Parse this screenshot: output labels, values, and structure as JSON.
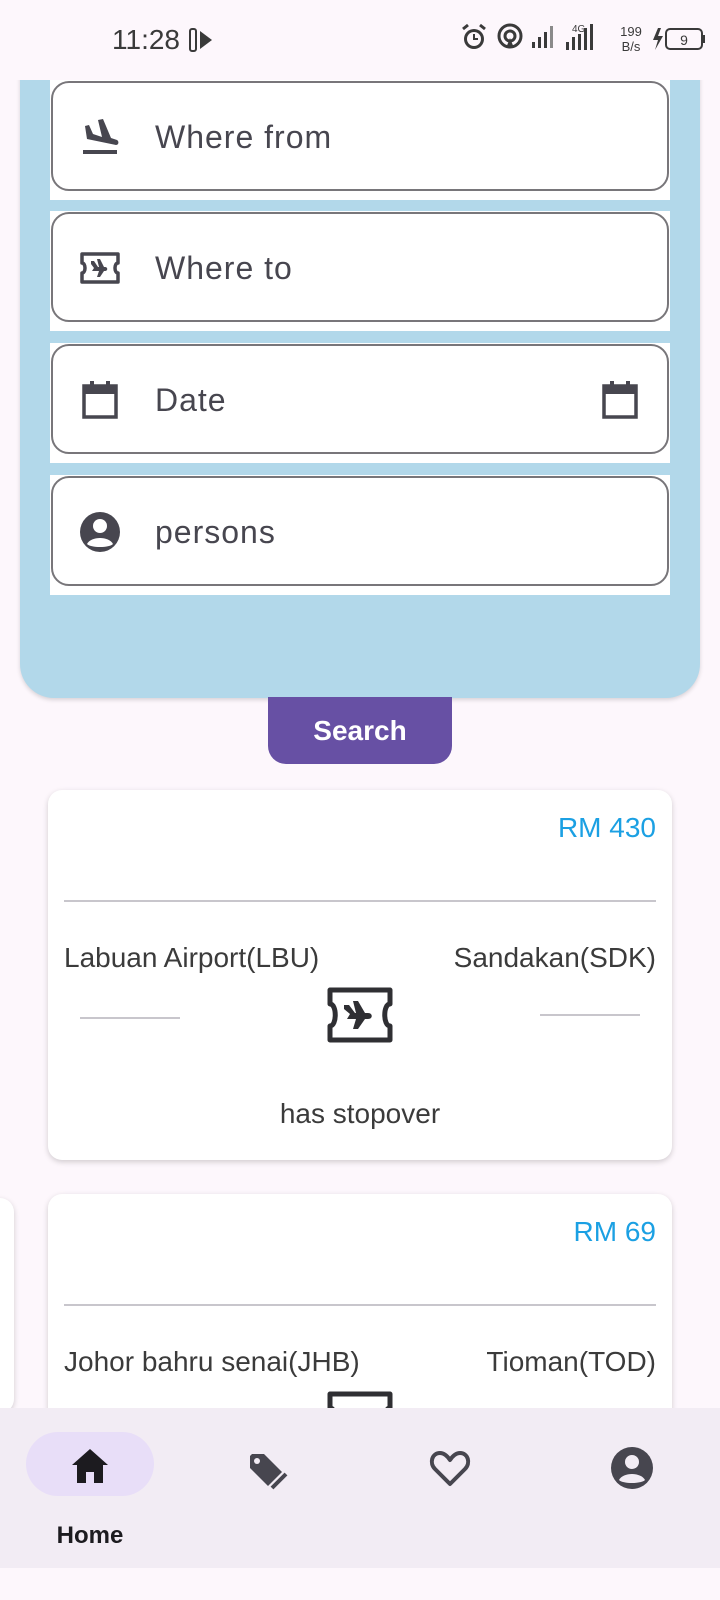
{
  "status_bar": {
    "time": "11:28",
    "net_speed_value": "199",
    "net_speed_unit": "B/s",
    "network_type": "4G",
    "battery": "9"
  },
  "search_form": {
    "fields": [
      {
        "placeholder": "Where from",
        "icon": "flight-land-icon"
      },
      {
        "placeholder": "Where to",
        "icon": "airplane-ticket-icon"
      },
      {
        "placeholder": "Date",
        "icon": "calendar-icon",
        "trailing_icon": "calendar-icon"
      },
      {
        "placeholder": "persons",
        "icon": "account-circle-icon"
      }
    ],
    "panel_color": "#b2d8ea",
    "search_label": "Search",
    "search_color": "#6750a4"
  },
  "flights": [
    {
      "price": "RM 430",
      "from": "Labuan Airport(LBU)",
      "to": "Sandakan(SDK)",
      "note": "has stopover"
    },
    {
      "price": "RM 69",
      "from": "Johor bahru senai(JHB)",
      "to": "Tioman(TOD)",
      "note": ""
    }
  ],
  "price_color": "#1ba0e3",
  "bottom_nav": {
    "items": [
      {
        "label": "Home",
        "icon": "home-icon",
        "active": true
      },
      {
        "label": "",
        "icon": "tag-icon",
        "active": false
      },
      {
        "label": "",
        "icon": "heart-icon",
        "active": false
      },
      {
        "label": "",
        "icon": "account-circle-icon",
        "active": false
      }
    ]
  }
}
